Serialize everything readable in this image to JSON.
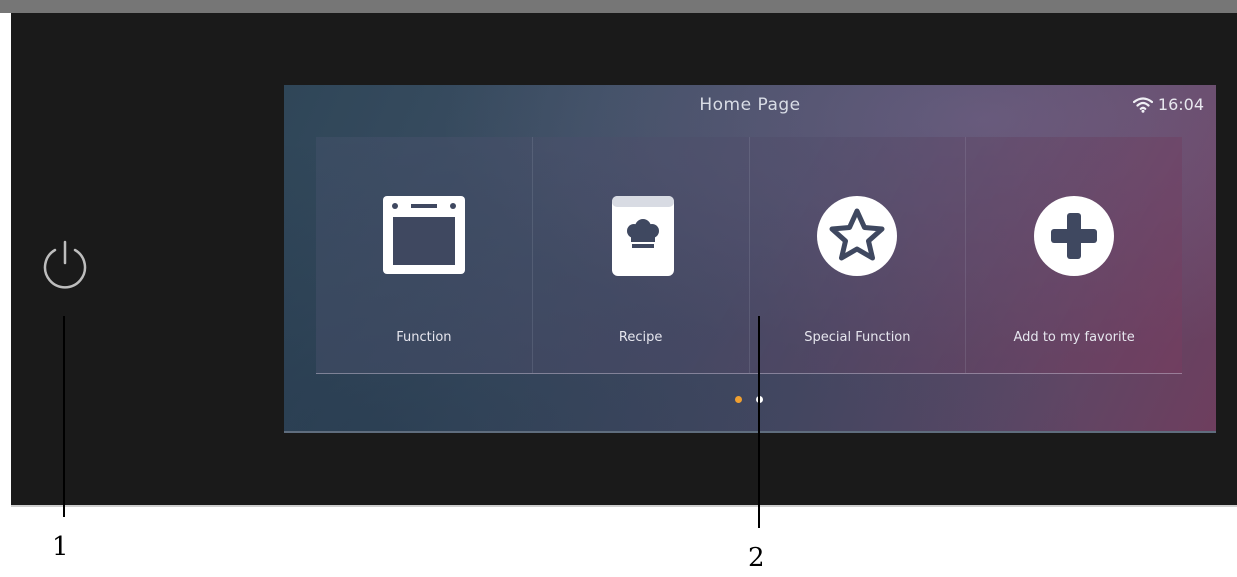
{
  "screen": {
    "title": "Home Page",
    "time": "16:04",
    "status_icon": "wifi-icon"
  },
  "tiles": [
    {
      "label": "Function",
      "icon": "oven-icon"
    },
    {
      "label": "Recipe",
      "icon": "recipe-book-icon"
    },
    {
      "label": "Special Function",
      "icon": "star-icon"
    },
    {
      "label": "Add to my favorite",
      "icon": "plus-icon"
    }
  ],
  "pager": {
    "active": 0,
    "colors": {
      "active": "#f0a030",
      "inactive": "#ffffff"
    }
  },
  "power_button": {
    "icon": "power-icon"
  },
  "callouts": {
    "one": "1",
    "two": "2"
  },
  "colors": {
    "panel": "#1a1a1a",
    "accent": "#f0a030"
  }
}
